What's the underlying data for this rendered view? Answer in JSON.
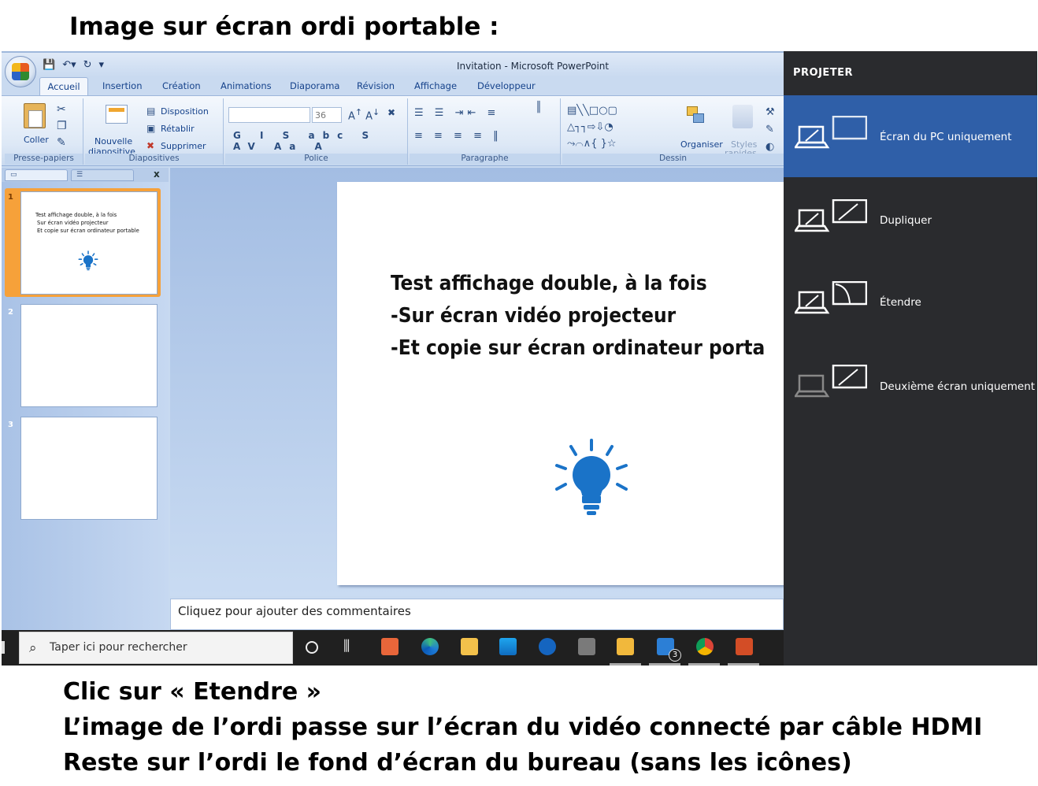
{
  "captions": {
    "top": "Image sur écran ordi portable :",
    "bottom": [
      "Clic sur « Etendre »",
      "L’image de l’ordi passe sur l’écran du vidéo connecté par câble HDMI",
      "Reste sur l’ordi le fond d’écran du bureau (sans les icônes)"
    ]
  },
  "ppt": {
    "window_title": "Invitation - Microsoft PowerPoint",
    "tabs": [
      "Accueil",
      "Insertion",
      "Création",
      "Animations",
      "Diaporama",
      "Révision",
      "Affichage",
      "Développeur"
    ],
    "ribbon": {
      "clipboard": {
        "label": "Presse-papiers",
        "paste": "Coller"
      },
      "slides": {
        "label": "Diapositives",
        "new_slide_1": "Nouvelle",
        "new_slide_2": "diapositive",
        "layout": "Disposition",
        "reset": "Rétablir",
        "delete": "Supprimer"
      },
      "font": {
        "label": "Police",
        "size": "36"
      },
      "paragraph": {
        "label": "Paragraphe"
      },
      "drawing": {
        "label": "Dessin",
        "arrange": "Organiser",
        "styles_1": "Styles",
        "styles_2": "rapides"
      }
    },
    "thumbnails": [
      {
        "num": "1",
        "lines": [
          "Test affichage double,  à la fois",
          "Sur écran vidéo projecteur",
          "Et copie sur écran ordinateur  portable"
        ]
      },
      {
        "num": "2",
        "lines": []
      },
      {
        "num": "3",
        "lines": []
      }
    ],
    "slide_lines": [
      "Test affichage double, à la fois",
      "-Sur écran vidéo projecteur",
      "-Et copie sur écran ordinateur porta"
    ],
    "notes_placeholder": "Cliquez pour ajouter des commentaires",
    "close_pane": "x"
  },
  "taskbar": {
    "search_placeholder": "Taper ici pour rechercher",
    "mail_badge": "3"
  },
  "project_panel": {
    "title": "PROJETER",
    "options": [
      "Écran du PC uniquement",
      "Dupliquer",
      "Étendre",
      "Deuxième écran uniquement"
    ],
    "selected": "Écran du PC uniquement",
    "accent_color": "#2f5fa8"
  }
}
